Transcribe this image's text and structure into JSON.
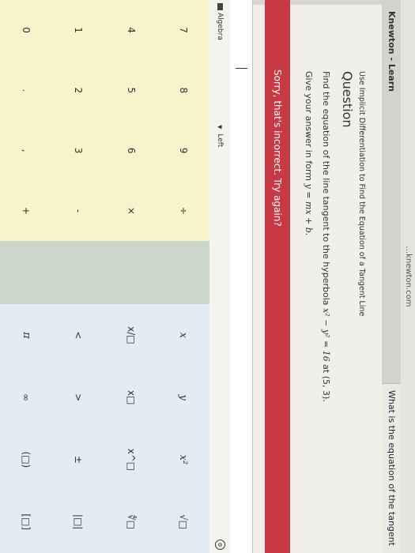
{
  "browser": {
    "tab_title": "...knewton.com"
  },
  "app": {
    "title": "Knewton - Learn"
  },
  "tab": {
    "label": "What is the equation of the tangent"
  },
  "question": {
    "breadcrumb": "Use Implicit Differentiation to Find the Equation of a Tangent Line",
    "heading": "Question",
    "text_prefix": "Find the equation of the line tangent to the hyperbola ",
    "equation": "x² − y² = 16",
    "text_mid": " at ",
    "point": "(5, 3)",
    "text_end": ".",
    "give_prefix": "Give your answer in form ",
    "give_form": "y = mx + b",
    "give_end": "."
  },
  "feedback": {
    "error": "Sorry, that's incorrect. Try again?"
  },
  "answer": {
    "value": ""
  },
  "keyboard": {
    "tab_label": "Algebra",
    "left_label": "Left",
    "number_keys": [
      "7",
      "8",
      "9",
      "÷",
      "4",
      "5",
      "6",
      "×",
      "1",
      "2",
      "3",
      "-",
      "0",
      ".",
      ",",
      "+"
    ],
    "operator_keys": [
      "",
      "",
      "",
      ""
    ],
    "symbol_keys": [
      "x",
      "y",
      "x²",
      "√□",
      "x/□",
      "x□",
      "x^□",
      "∜□",
      "<",
      ">",
      "±",
      "|□|",
      "π",
      "∞",
      "(□)",
      "[□]"
    ]
  },
  "colors": {
    "error": "#c73a44",
    "numpad": "#f7f4cc",
    "opspad": "#cdd7c9",
    "sympad": "#e2ecf2"
  }
}
